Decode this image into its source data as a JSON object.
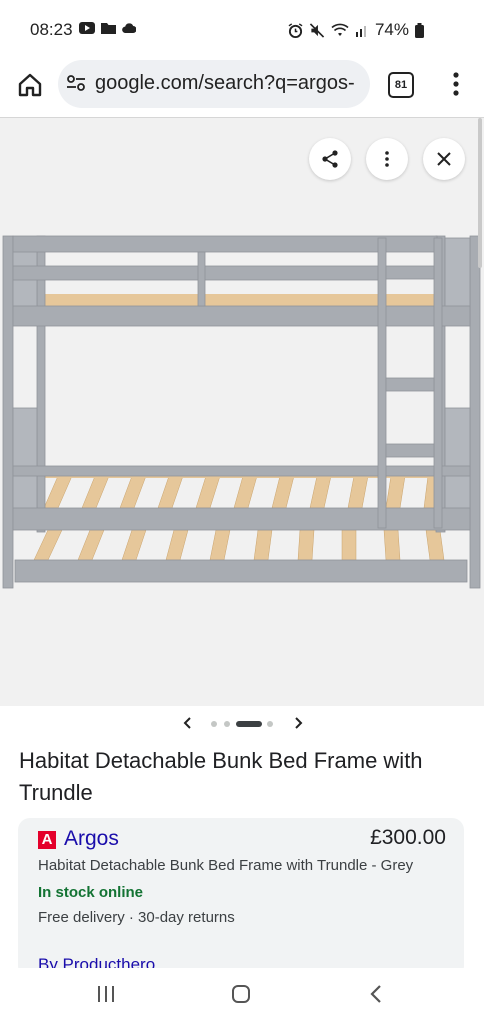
{
  "status_bar": {
    "time": "08:23",
    "battery": "74%",
    "left_icons": [
      "youtube-icon",
      "folder-icon",
      "cloud-icon"
    ],
    "right_icons": [
      "alarm-icon",
      "mute-icon",
      "wifi-icon",
      "signal-icon",
      "battery-icon"
    ]
  },
  "browser": {
    "url": "google.com/search?q=argos-",
    "tab_count": "81"
  },
  "image_viewer": {
    "buttons": [
      "share-icon",
      "more-vert-icon",
      "close-icon"
    ],
    "carousel_active_index": 2,
    "carousel_dot_count": 5
  },
  "product": {
    "title": "Habitat Detachable Bunk Bed Frame with Trundle",
    "seller": "Argos",
    "seller_logo_letter": "A",
    "price": "£300.00",
    "description": "Habitat Detachable Bunk Bed Frame with Trundle - Grey",
    "stock": "In stock online",
    "delivery": "Free delivery · 30-day returns",
    "byline": "By Producthero"
  },
  "colors": {
    "link": "#1a0dab",
    "stock_green": "#137333",
    "argos_red": "#e4002b",
    "frame_grey": "#a8acb2",
    "slat_pine": "#e6c79a"
  }
}
